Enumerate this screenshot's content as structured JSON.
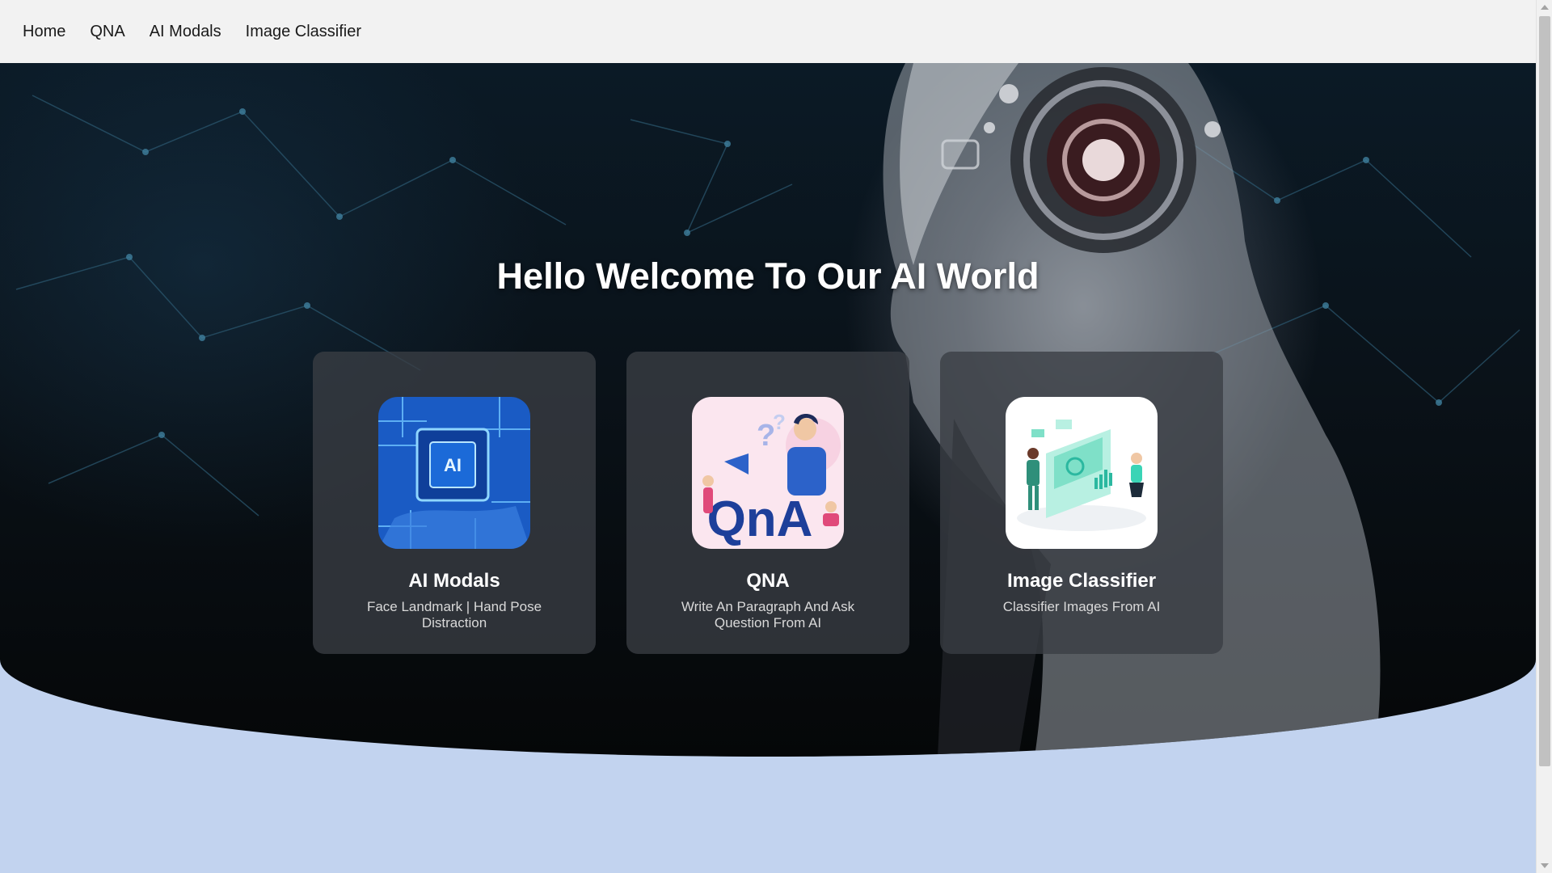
{
  "nav": {
    "items": [
      {
        "label": "Home"
      },
      {
        "label": "QNA"
      },
      {
        "label": "AI Modals"
      },
      {
        "label": "Image Classifier"
      }
    ]
  },
  "hero": {
    "title": "Hello Welcome To Our AI World"
  },
  "cards": [
    {
      "title": "AI Modals",
      "description": "Face Landmark | Hand Pose Distraction",
      "image": "ai-chip-image",
      "image_text": "AI"
    },
    {
      "title": "QNA",
      "description": "Write An Paragraph And Ask Question From AI",
      "image": "qna-illustration-image",
      "image_text": "QnA"
    },
    {
      "title": "Image Classifier",
      "description": "Classifier Images From AI",
      "image": "data-dashboard-illustration-image"
    }
  ],
  "colors": {
    "navbar_bg": "#f2f2f2",
    "page_bg": "#c2d3ef",
    "hero_dark": "#0a1219",
    "card_bg": "#3a3e44"
  }
}
